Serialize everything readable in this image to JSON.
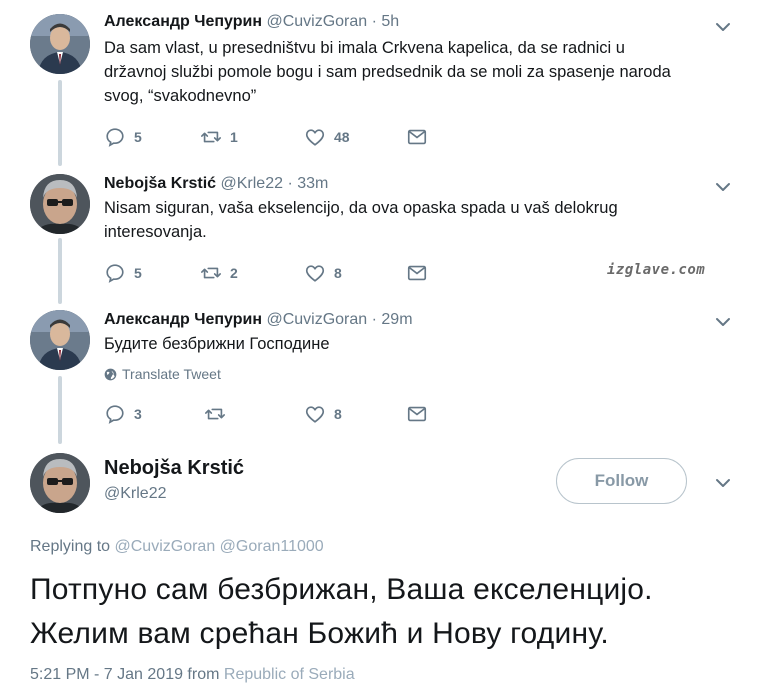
{
  "tweets": [
    {
      "name": "Александр Чепурин",
      "handle": "@CuvizGoran",
      "time": "5h",
      "text": "Da sam vlast, u presedništvu bi imala Crkvena kapelica, da se radnici u državnoj službi pomole bogu i sam predsednik da se moli za spasenje naroda svog, “svakodnevno”",
      "replies": "5",
      "retweets": "1",
      "likes": "48"
    },
    {
      "name": "Nebojša Krstić",
      "handle": "@Krle22",
      "time": "33m",
      "text": "Nisam siguran, vaša ekselencijo, da ova opaska spada u vaš delokrug interesovanja.",
      "replies": "5",
      "retweets": "2",
      "likes": "8"
    },
    {
      "name": "Александр Чепурин",
      "handle": "@CuvizGoran",
      "time": "29m",
      "text": "Будите безбрижни Господине",
      "translate_label": "Translate Tweet",
      "replies": "3",
      "retweets": "",
      "likes": "8"
    }
  ],
  "watermark": "izglave.com",
  "main_tweet": {
    "name": "Nebojša Krstić",
    "handle": "@Krle22",
    "follow_label": "Follow",
    "replying_prefix": "Replying to",
    "replying_to": [
      "@CuvizGoran",
      "@Goran11000"
    ],
    "text_line1": "Потпуно сам безбрижан, Ваша екселенцијо.",
    "text_line2": "Желим вам срећан Божић и Нову годину.",
    "timestamp": "5:21 PM - 7 Jan 2019 from",
    "location": "Republic of Serbia"
  },
  "icons": [
    "reply-icon",
    "retweet-icon",
    "like-icon",
    "dm-icon",
    "chevron-down-icon",
    "globe-icon"
  ],
  "colors": {
    "text": "#14171a",
    "muted": "#657786",
    "line": "#ccd6dd"
  }
}
